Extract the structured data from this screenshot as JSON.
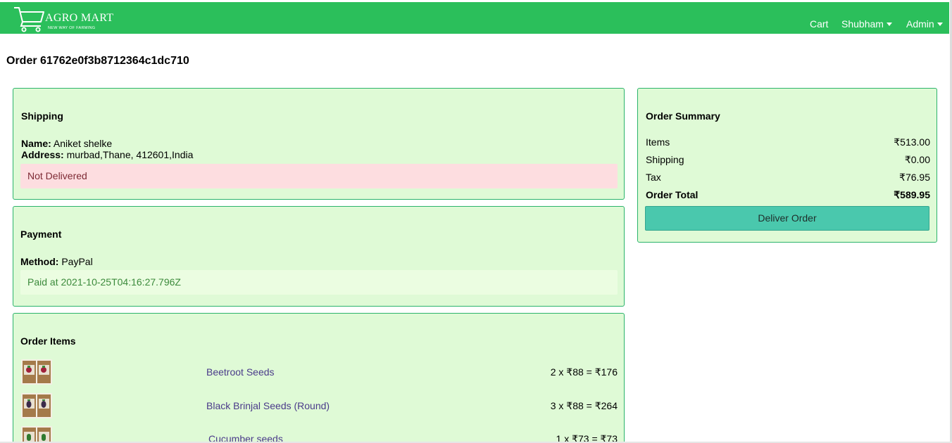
{
  "brand": {
    "name": "AGRO MART",
    "tagline": "NEW WAY OF FARMING"
  },
  "nav": {
    "cart": "Cart",
    "user": "Shubham",
    "admin": "Admin"
  },
  "order": {
    "title": "Order 61762e0f3b8712364c1dc710"
  },
  "shipping": {
    "heading": "Shipping",
    "name_label": "Name:",
    "name": "Aniket shelke",
    "address_label": "Address:",
    "address": "murbad,Thane, 412601,India",
    "status": "Not Delivered"
  },
  "payment": {
    "heading": "Payment",
    "method_label": "Method:",
    "method": "PayPal",
    "status": "Paid at 2021-10-25T04:16:27.796Z"
  },
  "order_items": {
    "heading": "Order Items",
    "items": [
      {
        "name": "Beetroot Seeds",
        "price": "2 x ₹88 = ₹176"
      },
      {
        "name": "Black Brinjal Seeds (Round)",
        "price": "3 x ₹88 = ₹264"
      },
      {
        "name": "Cucumber seeds",
        "price": "1 x ₹73 = ₹73"
      }
    ]
  },
  "summary": {
    "heading": "Order Summary",
    "items_label": "Items",
    "items_value": "₹513.00",
    "shipping_label": "Shipping",
    "shipping_value": "₹0.00",
    "tax_label": "Tax",
    "tax_value": "₹76.95",
    "total_label": "Order Total",
    "total_value": "₹589.95",
    "deliver_button": "Deliver Order"
  },
  "colors": {
    "navbar": "#2bbf5b",
    "card_bg": "#dffad6",
    "card_border": "#2bb36b",
    "danger_bg": "#fddde0",
    "success_bg": "#ebfde1",
    "deliver_button": "#4ac8ad",
    "link": "#4a3a8a"
  },
  "icons": {
    "brand_logo": "shopping-cart-icon",
    "dropdown": "caret-down-icon"
  }
}
